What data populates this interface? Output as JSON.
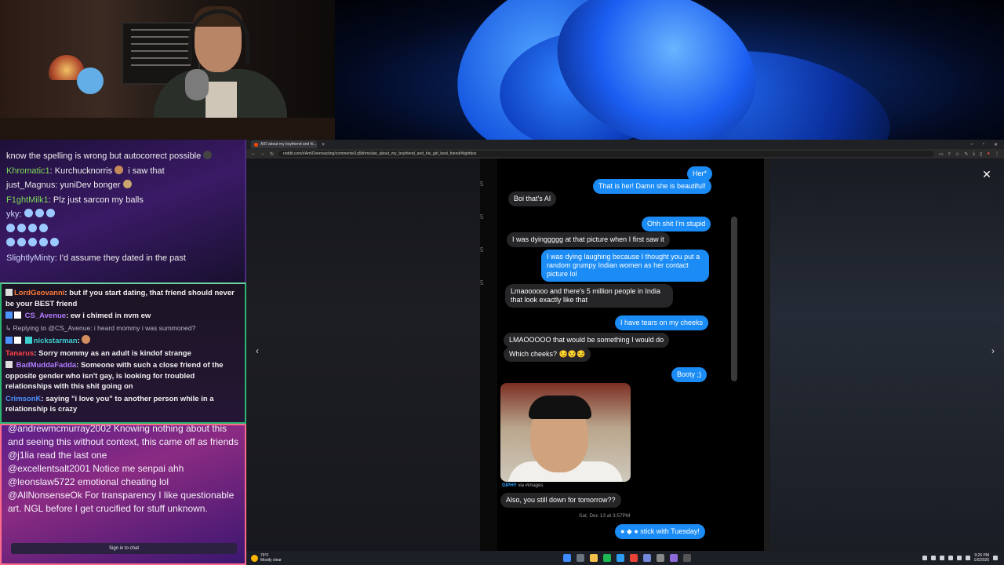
{
  "chat_top": {
    "lines": [
      {
        "user": "",
        "text": "know the spelling is wrong but autocorrect possible"
      },
      {
        "user": "Khromatic1",
        "text": ": Kurchucknorris",
        "tail": " i saw that"
      },
      {
        "user": "just_Magnus",
        "text": ": yuniDev bonger"
      },
      {
        "user": "F1ghtMilk1",
        "text": ": Plz just sarcon my balls"
      },
      {
        "user": "yky",
        "text": ":"
      },
      {
        "user": "SlightlyMinty",
        "text": ": I'd assume they dated in the past"
      }
    ]
  },
  "chat_mid": {
    "m1_user": "LordGeovanni",
    "m1_text": ": but if you start dating, that friend should never be your BEST friend",
    "m2_user": "CS_Avenue",
    "m2_text": ": ew i chimed in nvm ew",
    "m3_reply": "Replying to @CS_Avenue: i heard mommy i was summoned?",
    "m3_user": "nickstarman",
    "m3_text": ":",
    "m4_user": "Tanarus",
    "m4_text": ": Sorry mommy as an adult is kindof strange",
    "m5_user": "BadMuddaFadda",
    "m5_text": ": Someone with such a close friend of the opposite gender who isn't gay, is looking for troubled relationships with this shit going on",
    "m6_user": "CrimsonK",
    "m6_text": ": saying \"i love you\" to another person while in a relationship is crazy"
  },
  "chat_bot": {
    "lines": [
      "@andrewmcmurray2002 Knowing nothing about this and seeing this without context, this came off as friends",
      "@j1lia read the last one",
      "@excellentsalt2001 Notice me senpai ahh",
      "@leonslaw5722 emotional cheating lol",
      "@AllNonsenseOk For transparency I like questionable art. NGL before I get crucified for stuff unknown."
    ],
    "signin": "Sign in to chat"
  },
  "browser": {
    "tab_title": "AIO about my boyfriend and hi...",
    "new_tab": "+",
    "url": "reddit.com/r/AmIOverreacting/comments/1q5bhmx/aio_about_my_boyfriend_and_his_girl_best_friend/#lightbox",
    "close_icon": "✕",
    "prev_icon": "‹",
    "next_icon": "›"
  },
  "conversation": {
    "messages": [
      {
        "side": "sent",
        "text": "Her*"
      },
      {
        "side": "sent",
        "text": "That is her! Damn she is beautiful!"
      },
      {
        "side": "recv",
        "text": "Boi that's AI"
      },
      {
        "side": "sent",
        "text": "Ohh shit I'm stupid"
      },
      {
        "side": "recv",
        "text": "I was dyinggggg at that picture when I first saw it"
      },
      {
        "side": "sent",
        "text": "I was dying laughing because I thought you put a random grumpy Indian women as her contact picture lol"
      },
      {
        "side": "recv",
        "text": "Lmaoooooo and there's 5 million people in India that look exactly like that"
      },
      {
        "side": "sent",
        "text": "I have tears on my cheeks"
      },
      {
        "side": "recv",
        "text": "LMAOOOOO that would be something I would do"
      },
      {
        "side": "recv",
        "text": "Which cheeks? 😏😏😏"
      },
      {
        "side": "sent",
        "text": "Booty ;)"
      },
      {
        "side": "recv",
        "text": "Also, you still down for tomorrow??"
      },
      {
        "side": "sent",
        "text": "stick with Tuesday!"
      }
    ],
    "giphy_label": "GIPHY",
    "via_text": " via #images",
    "timestamp": "Sat, Dec 13 at 3:57PM"
  },
  "taskbar": {
    "temp": "76°F",
    "weather": "Mostly clear",
    "time": "9:26 PM",
    "date": "1/6/2026"
  }
}
